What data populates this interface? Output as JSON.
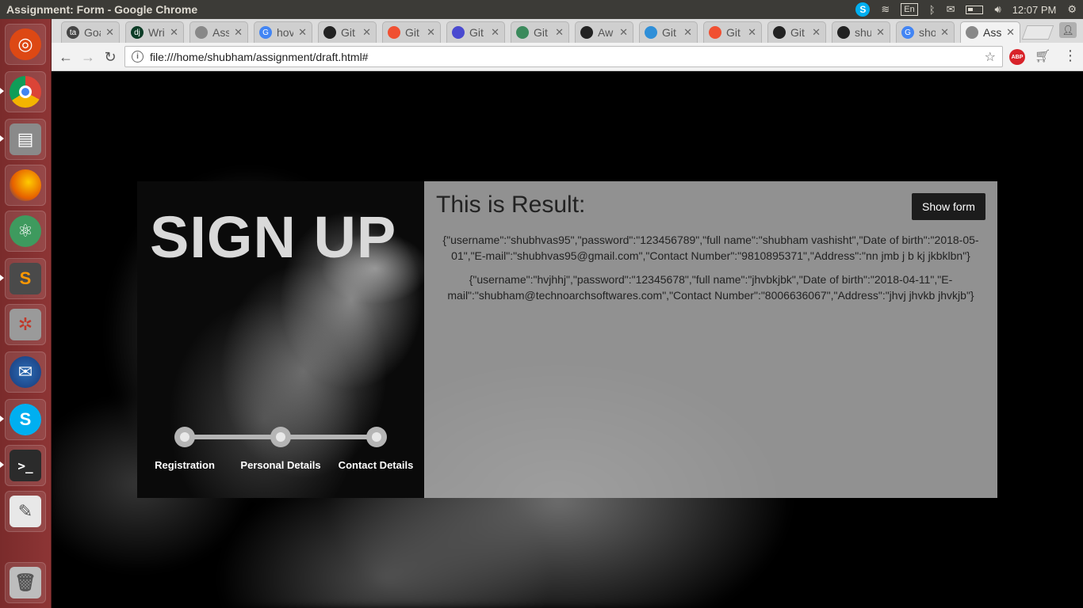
{
  "window": {
    "title": "Assignment: Form - Google Chrome"
  },
  "indicators": {
    "keyboard": "En",
    "time": "12:07 PM"
  },
  "tabs": [
    {
      "label": "Goa",
      "favicon": "ta",
      "color": "#444444"
    },
    {
      "label": "Wri",
      "favicon": "dj",
      "color": "#0c3c26"
    },
    {
      "label": "Ass",
      "favicon": "",
      "color": "#888888"
    },
    {
      "label": "hov",
      "favicon": "G",
      "color": "#4285f4"
    },
    {
      "label": "Git",
      "favicon": "",
      "color": "#222222"
    },
    {
      "label": "Git",
      "favicon": "",
      "color": "#f05032"
    },
    {
      "label": "Git",
      "favicon": "",
      "color": "#4a4ad0"
    },
    {
      "label": "Git",
      "favicon": "",
      "color": "#3b8a5c"
    },
    {
      "label": "Aw",
      "favicon": "",
      "color": "#222222"
    },
    {
      "label": "Git",
      "favicon": "",
      "color": "#2f8fd8"
    },
    {
      "label": "Git",
      "favicon": "",
      "color": "#f05032"
    },
    {
      "label": "Git",
      "favicon": "",
      "color": "#222222"
    },
    {
      "label": "shu",
      "favicon": "",
      "color": "#222222"
    },
    {
      "label": "sho",
      "favicon": "G",
      "color": "#4285f4"
    },
    {
      "label": "Ass",
      "favicon": "",
      "color": "#888888",
      "active": true
    }
  ],
  "toolbar": {
    "url": "file:///home/shubham/assignment/draft.html#",
    "abp_label": "ABP"
  },
  "signup": {
    "title": "SIGN UP",
    "steps": [
      "Registration",
      "Personal Details",
      "Contact Details"
    ]
  },
  "result": {
    "title": "This is Result:",
    "show_form_label": "Show form",
    "items": [
      "{\"username\":\"shubhvas95\",\"password\":\"123456789\",\"full name\":\"shubham vashisht\",\"Date of birth\":\"2018-05-01\",\"E-mail\":\"shubhvas95@gmail.com\",\"Contact Number\":\"9810895371\",\"Address\":\"nn jmb j b kj jkbklbn\"}",
      "{\"username\":\"hvjhhj\",\"password\":\"12345678\",\"full name\":\"jhvbkjbk\",\"Date of birth\":\"2018-04-11\",\"E-mail\":\"shubham@technoarchsoftwares.com\",\"Contact Number\":\"8006636067\",\"Address\":\"jhvj jhvkb jhvkjb\"}"
    ]
  }
}
